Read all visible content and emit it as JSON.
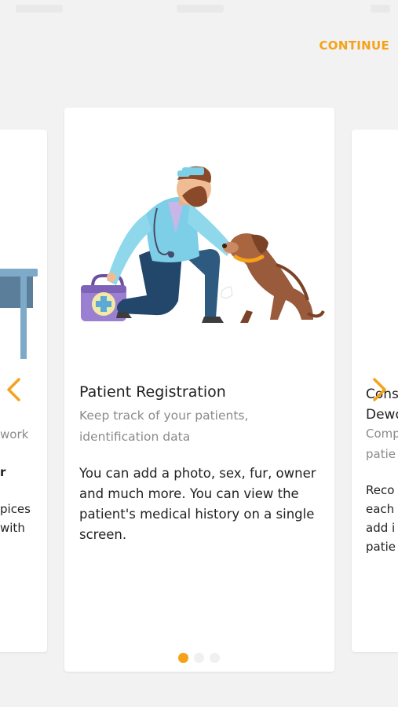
{
  "header": {
    "continue_label": "CONTINUE"
  },
  "accent_color": "#f5a21a",
  "main_card": {
    "title": "Patient Registration",
    "subtitle": "Keep track of your patients, identification data",
    "description": "You can add a photo, sex, fur, owner and much more. You can view the patient's medical history on a single screen.",
    "illustration": "vet-with-dog-illustration"
  },
  "prev_card": {
    "line1": "work",
    "line2": "r",
    "line3": "pices",
    "line4": "with"
  },
  "next_card": {
    "line1": "Cons",
    "line2": "Dewo",
    "line3": "Comp",
    "line4": "patie",
    "line5": "Reco",
    "line6": "each",
    "line7": "add i",
    "line8": "patie"
  },
  "pagination": {
    "total": 3,
    "active_index": 0
  },
  "icons": {
    "prev": "chevron-left-icon",
    "next": "chevron-right-icon"
  }
}
